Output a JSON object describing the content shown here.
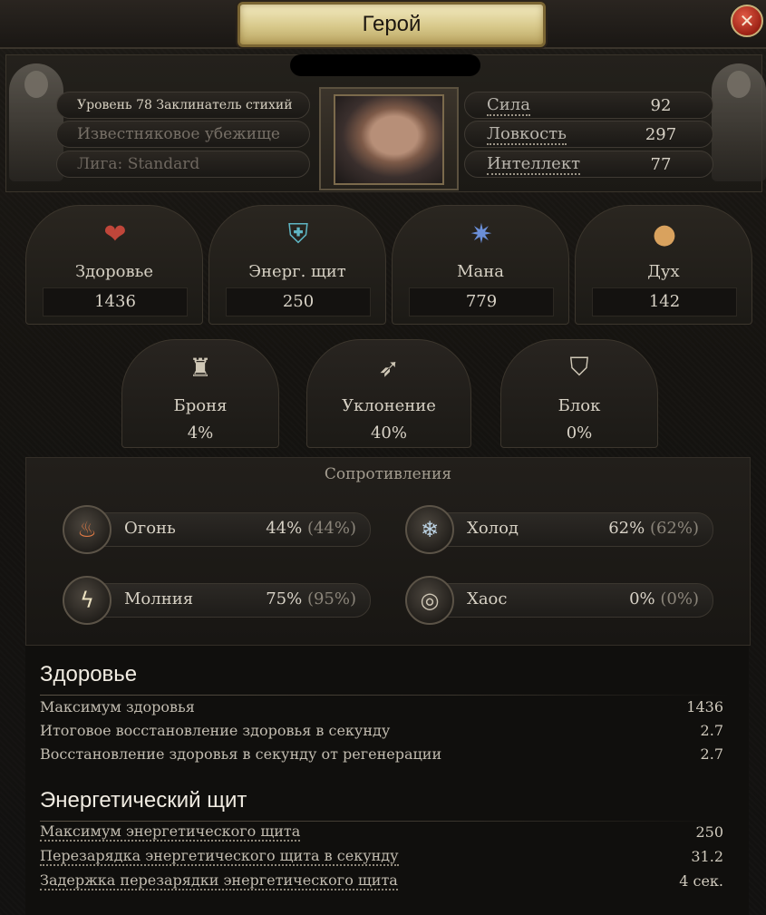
{
  "window": {
    "title": "Герой",
    "close_symbol": "✕"
  },
  "header": {
    "level_class": "Уровень 78 Заклинатель стихий",
    "location": "Известняковое убежище",
    "league": "Лига: Standard",
    "attributes": [
      {
        "label": "Сила",
        "value": "92"
      },
      {
        "label": "Ловкость",
        "value": "297"
      },
      {
        "label": "Интеллект",
        "value": "77"
      }
    ]
  },
  "stats": [
    {
      "label": "Здоровье",
      "value": "1436",
      "icon": "heart-icon",
      "color": "#c0463a"
    },
    {
      "label": "Энерг. щит",
      "value": "250",
      "icon": "shield-icon",
      "color": "#5fb6c4"
    },
    {
      "label": "Мана",
      "value": "779",
      "icon": "mana-crystal-icon",
      "color": "#6b8fd8"
    },
    {
      "label": "Дух",
      "value": "142",
      "icon": "spirit-orb-icon",
      "color": "#d9a25e"
    }
  ],
  "defences": [
    {
      "label": "Броня",
      "value": "4%",
      "icon": "armour-icon"
    },
    {
      "label": "Уклонение",
      "value": "40%",
      "icon": "evasion-icon"
    },
    {
      "label": "Блок",
      "value": "0%",
      "icon": "block-shield-icon"
    }
  ],
  "resistances": {
    "title": "Сопротивления",
    "items": [
      {
        "name": "Огонь",
        "value": "44%",
        "max": "(44%)",
        "icon": "fire-icon"
      },
      {
        "name": "Холод",
        "value": "62%",
        "max": "(62%)",
        "icon": "cold-icon"
      },
      {
        "name": "Молния",
        "value": "75%",
        "max": "(95%)",
        "icon": "lightning-icon"
      },
      {
        "name": "Хаос",
        "value": "0%",
        "max": "(0%)",
        "icon": "chaos-icon"
      }
    ]
  },
  "details": {
    "life": {
      "title": "Здоровье",
      "rows": [
        {
          "label": "Максимум здоровья",
          "value": "1436"
        },
        {
          "label": "Итоговое восстановление здоровья в секунду",
          "value": "2.7"
        },
        {
          "label": "Восстановление здоровья в секунду от регенерации",
          "value": "2.7"
        }
      ]
    },
    "energy_shield": {
      "title": "Энергетический щит",
      "rows": [
        {
          "label": "Максимум энергетического щита",
          "value": "250"
        },
        {
          "label": "Перезарядка энергетического щита в секунду",
          "value": "31.2"
        },
        {
          "label": "Задержка перезарядки энергетического щита",
          "value": "4 сек."
        }
      ]
    }
  }
}
